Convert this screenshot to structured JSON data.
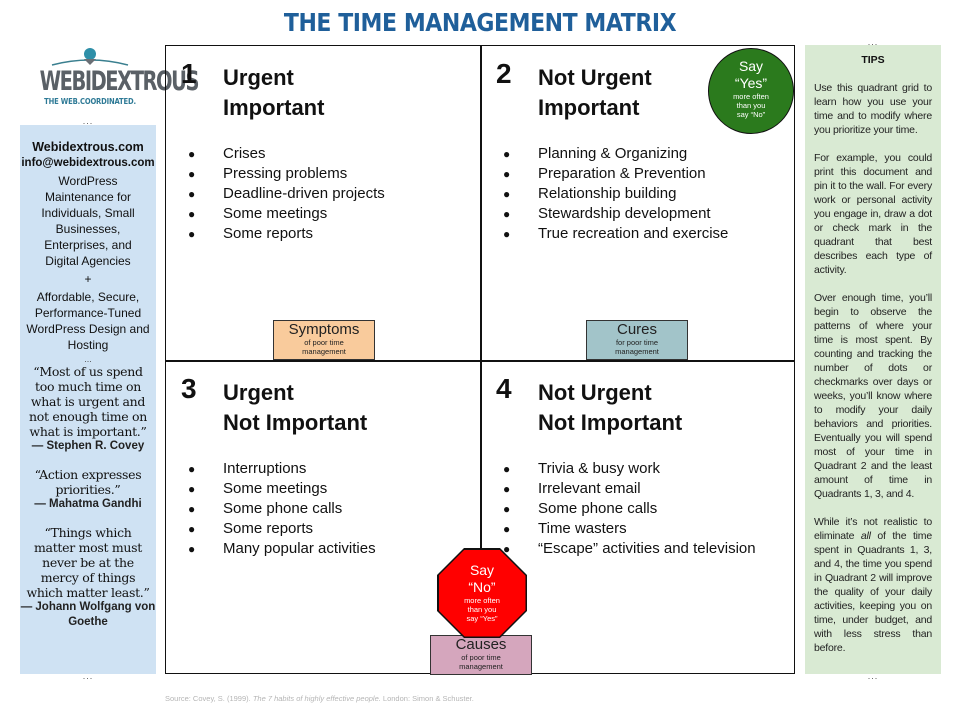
{
  "title": "THE TIME MANAGEMENT MATRIX",
  "logo": {
    "brand": "WEBIDEXTROUS",
    "tagline": "THE WEB.COORDINATED.",
    "icon": "handshake-globe-icon"
  },
  "left_panel": {
    "separator": "...",
    "site": "Webidextrous.com",
    "email": "info@webidextrous.com",
    "description_1": "WordPress Maintenance for Individuals, Small Businesses, Enterprises, and Digital Agencies",
    "plus": "+",
    "description_2": "Affordable, Secure, Performance-Tuned WordPress Design and Hosting",
    "quotes": [
      {
        "text": "“Most of us spend too much time on what is urgent and not enough time on what is important.”",
        "author": "— Stephen R. Covey"
      },
      {
        "text": "“Action expresses priorities.”",
        "author": "— Mahatma Gandhi"
      },
      {
        "text": "“Things which matter most must never be at the mercy of things which matter least.”",
        "author": "— Johann Wolfgang von Goethe"
      }
    ]
  },
  "tips": {
    "separator": "...",
    "title": "TIPS",
    "p1": "Use this quadrant grid to learn how you use your time and to modify where you prioritize your time.",
    "p2": "For example, you could print this document and pin it to the wall. For every work or personal activity you engage in, draw a dot or check mark in the quadrant that best describes each type of activity.",
    "p3": "Over enough time, you’ll begin to observe the patterns of where your time is most spent. By counting and tracking the number of dots or checkmarks over days or weeks, you’ll know where to modify your daily behaviors and priorities. Eventually you will spend most of your time in Quadrant 2 and the least amount of time in Quadrants 1, 3, and 4.",
    "p4_before": "While it’s not realistic to eliminate ",
    "p4_em": "all",
    "p4_after": " of the time spent in Quadrants 1, 3, and 4, the time you spend in Quadrant 2 will improve the quality of your daily activities, keeping you on time, under budget, and with less stress than before."
  },
  "quadrants": [
    {
      "number": "1",
      "line1": "Urgent",
      "line2": "Important",
      "items": [
        "Crises",
        "Pressing problems",
        "Deadline-driven projects",
        "Some meetings",
        "Some reports"
      ]
    },
    {
      "number": "2",
      "line1": "Not Urgent",
      "line2": "Important",
      "items": [
        "Planning & Organizing",
        "Preparation & Prevention",
        "Relationship building",
        "Stewardship development",
        "True recreation and exercise"
      ]
    },
    {
      "number": "3",
      "line1": "Urgent",
      "line2": "Not Important",
      "items": [
        "Interruptions",
        "Some meetings",
        "Some phone calls",
        "Some reports",
        "Many popular activities"
      ]
    },
    {
      "number": "4",
      "line1": "Not Urgent",
      "line2": "Not Important",
      "items": [
        "Trivia & busy work",
        "Irrelevant email",
        "Some phone calls",
        "Time wasters",
        "“Escape” activities and television"
      ]
    }
  ],
  "bullet": "●",
  "labels": {
    "symptoms": {
      "main": "Symptoms",
      "sub1": "of poor time",
      "sub2": "management",
      "color": "#f9cb9c"
    },
    "cures": {
      "main": "Cures",
      "sub1": "for poor time",
      "sub2": "management",
      "color": "#a2c4c9"
    },
    "causes": {
      "main": "Causes",
      "sub1": "of poor time",
      "sub2": "management",
      "color": "#d5a6bd"
    }
  },
  "say_yes": {
    "line1": "Say",
    "line2": "“Yes”",
    "sub1": "more often",
    "sub2": "than you",
    "sub3": "say “No”",
    "color": "#2b7a1d"
  },
  "say_no": {
    "line1": "Say",
    "line2": "“No”",
    "sub1": "more often",
    "sub2": "than you",
    "sub3": "say “Yes”",
    "color": "#ff0000"
  },
  "source": {
    "prefix": "Source: Covey, S. (1999). ",
    "title": "The 7 habits of highly effective people.",
    "suffix": " London: Simon & Schuster."
  }
}
